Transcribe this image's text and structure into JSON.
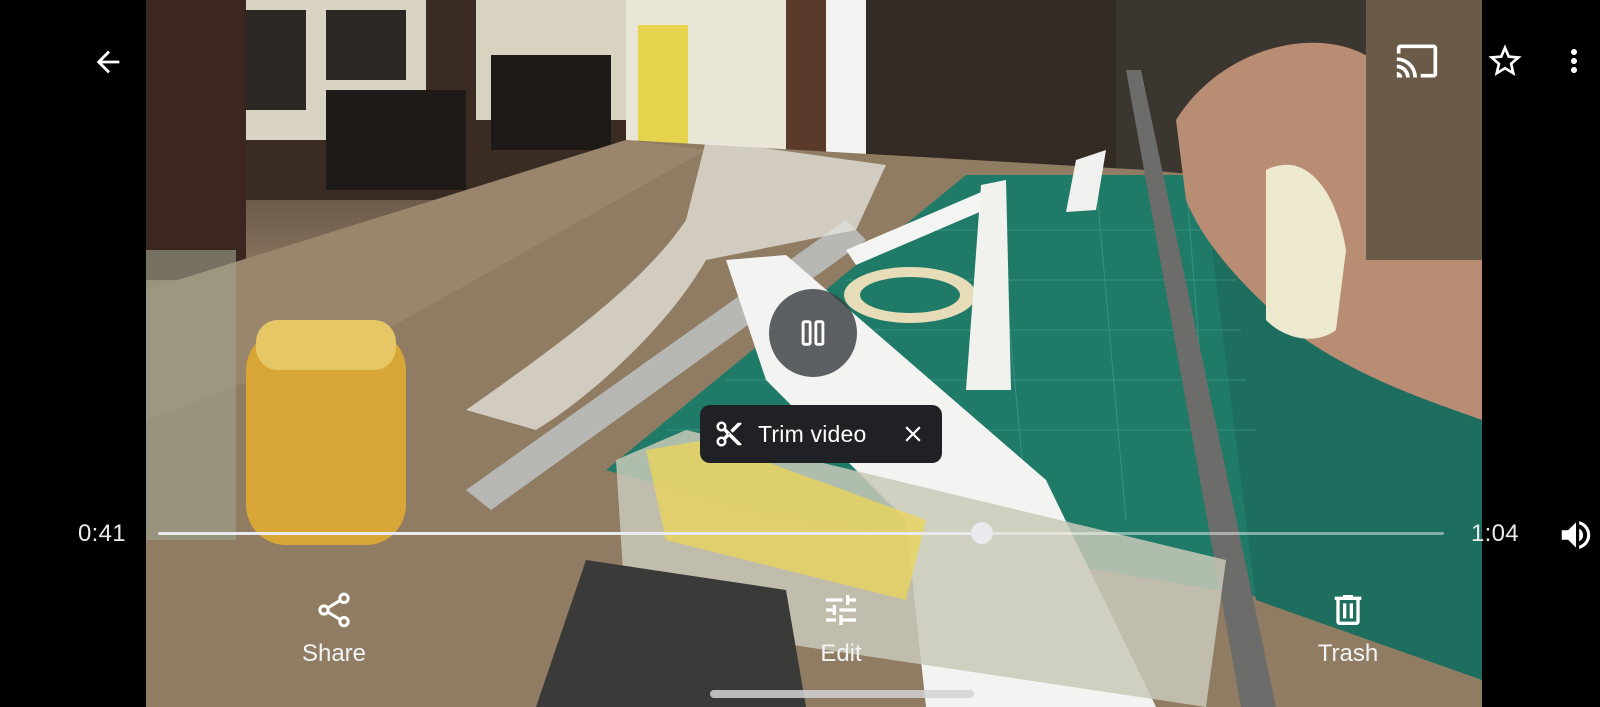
{
  "video": {
    "description_icon": "video-frame",
    "playback_state": "playing",
    "progress_fraction": 0.641
  },
  "toolbar": {
    "back_icon": "arrow-back-icon",
    "cast_icon": "cast-icon",
    "favorite_icon": "star-outline-icon",
    "more_icon": "more-vert-icon"
  },
  "player": {
    "pause_icon": "pause-icon",
    "current_time": "0:41",
    "total_time": "1:04",
    "volume_icon": "volume-up-icon"
  },
  "trim_chip": {
    "icon": "scissors-icon",
    "label": "Trim video",
    "close_icon": "close-icon"
  },
  "actions": [
    {
      "label": "Share",
      "icon": "share-icon"
    },
    {
      "label": "Edit",
      "icon": "tune-icon"
    },
    {
      "label": "Trash",
      "icon": "trash-icon"
    }
  ],
  "colors": {
    "background": "#000000",
    "chip": "#202124",
    "text": "#ffffff",
    "cutting_mat": "#1f7a68"
  }
}
